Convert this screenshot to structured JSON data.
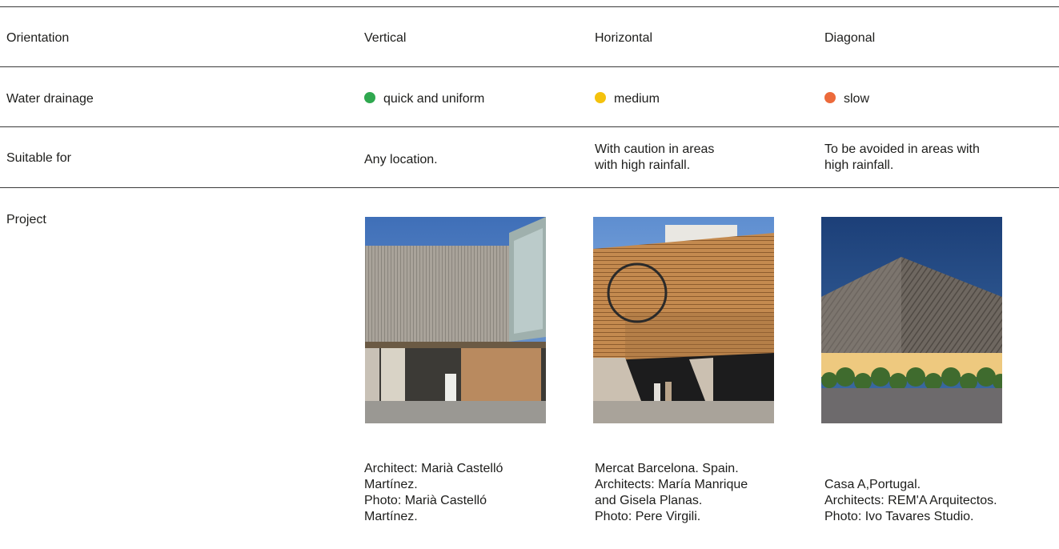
{
  "header": {
    "label": "Orientation",
    "columns": [
      "Vertical",
      "Horizontal",
      "Diagonal"
    ]
  },
  "drainage": {
    "label": "Water drainage",
    "values": [
      {
        "text": "quick and uniform",
        "color": "#2fa84f"
      },
      {
        "text": "medium",
        "color": "#f4c20d"
      },
      {
        "text": "slow",
        "color": "#ec6a3b"
      }
    ]
  },
  "suitable": {
    "label": "Suitable for",
    "values": [
      [
        "Any location."
      ],
      [
        "With caution in areas",
        "with high rainfall."
      ],
      [
        "To be avoided in areas with",
        "high rainfall."
      ]
    ]
  },
  "project": {
    "label": "Project",
    "captions": [
      [
        "Architect: Marià Castelló",
        "Martínez.",
        "Photo: Marià Castelló",
        "Martínez."
      ],
      [
        "Mercat Barcelona. Spain.",
        "Architects: María Manrique",
        "and Gisela Planas.",
        "Photo: Pere Virgili."
      ],
      [
        "Casa A,Portugal.",
        "Architects: REM'A Arquitectos.",
        "Photo: Ivo Tavares Studio."
      ]
    ]
  }
}
